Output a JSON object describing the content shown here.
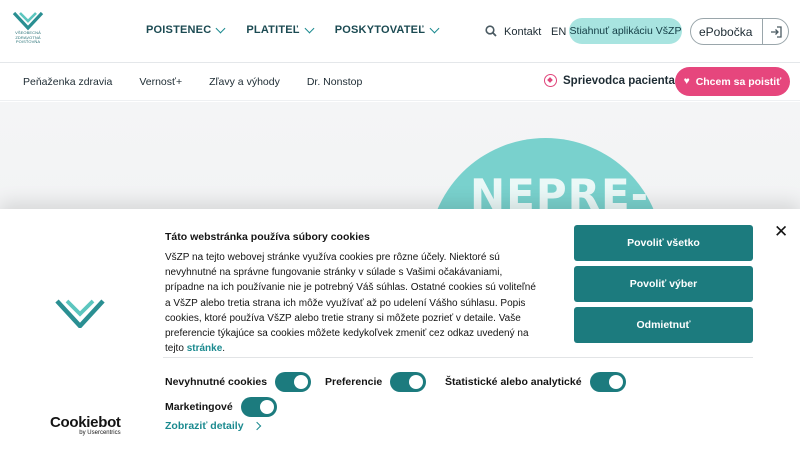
{
  "logo": {
    "lines": [
      "VŠEOBECNÁ",
      "ZDRAVOTNÁ",
      "POISŤOVŇA"
    ]
  },
  "header": {
    "nav": [
      {
        "label": "POISTENEC"
      },
      {
        "label": "PLATITEĽ"
      },
      {
        "label": "POSKYTOVATEĽ"
      }
    ],
    "kontakt": "Kontakt",
    "lang": "EN",
    "app_button": "Stiahnuť aplikáciu VšZP",
    "epobocka": "ePobočka"
  },
  "subnav": {
    "items": [
      "Peňaženka zdravia",
      "Vernosť+",
      "Zľavy a výhody",
      "Dr. Nonstop"
    ],
    "guide": "Sprievodca pacienta",
    "insure_button": "Chcem sa poistiť"
  },
  "hero": {
    "headline": "NEPRE-"
  },
  "cookie": {
    "title": "Táto webstránka používa súbory cookies",
    "body": "VšZP na tejto webovej stránke využíva cookies pre rôzne účely. Niektoré sú nevyhnutné na správne fungovanie stránky v súlade s Vašimi očakávaniami, prípadne na ich používanie nie je potrebný Váš súhlas. Ostatné cookies sú voliteľné a VšZP alebo tretia strana ich môže využívať až po udelení Vášho súhlasu. Popis cookies, ktoré používa VšZP alebo tretie strany si môžete pozrieť v detaile. Vaše preferencie týkajúce sa cookies môžete kedykoľvek zmeniť cez odkaz uvedený na tejto",
    "link": "stránke",
    "buttons": {
      "allow_all": "Povoliť všetko",
      "allow_selection": "Povoliť výber",
      "deny": "Odmietnuť"
    },
    "toggles": {
      "necessary": "Nevyhnutné cookies",
      "preferences": "Preferencie",
      "statistics": "Štatistické alebo analytické",
      "marketing": "Marketingové"
    },
    "details": "Zobraziť detaily",
    "brand": {
      "name": "Cookiebot",
      "by": "by Usercentrics"
    }
  },
  "colors": {
    "teal": "#1c7b7e",
    "pink": "#e6467d",
    "mint": "#a8e4e0"
  }
}
